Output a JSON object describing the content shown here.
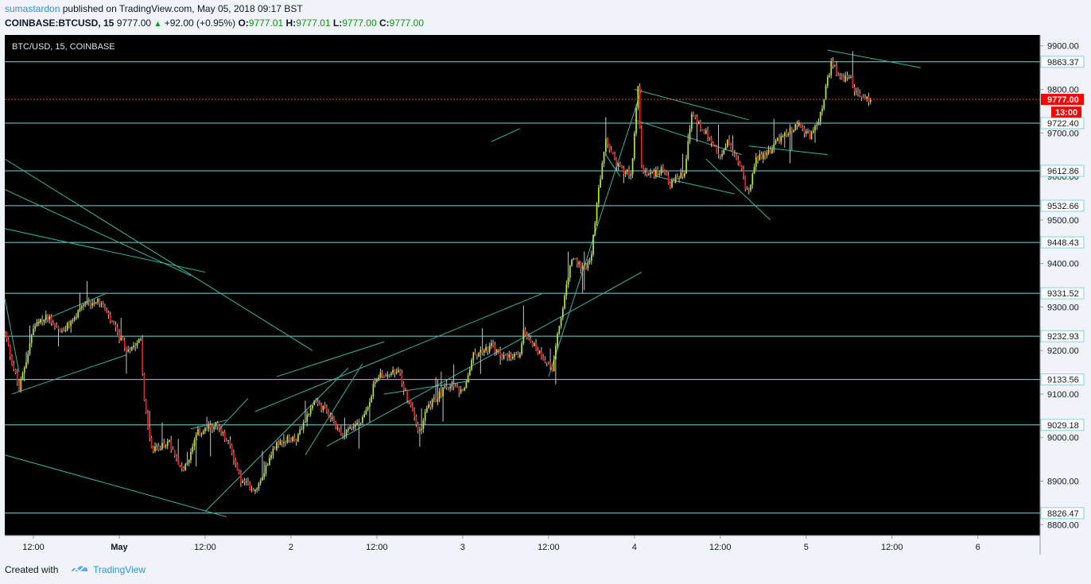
{
  "header": {
    "author": "sumastardon",
    "published_text": "published on TradingView.com, May 05, 2018 09:17 BST",
    "symbol": "COINBASE:BTCUSD, 15",
    "last": "9777.00",
    "change": "+92.00 (+0.95%)",
    "o_label": "O:",
    "o_val": "9777.01",
    "h_label": "H:",
    "h_val": "9777.01",
    "l_label": "L:",
    "l_val": "9777.00",
    "c_label": "C:",
    "c_val": "9777.00"
  },
  "footer": {
    "created_with": "Created with",
    "brand": "TradingView"
  },
  "colors": {
    "background": "#000000",
    "bull": "#b6ee20",
    "bear": "#ff1a1a",
    "level_line": "#7fd6d8",
    "trend_line": "#36b4a0",
    "current_price": "#ff0000",
    "axis_bg": "#f0f3fa"
  },
  "chart_data": {
    "type": "candlestick",
    "title": "BTC/USD, 15, COINBASE",
    "ylim": [
      8775,
      9925
    ],
    "y_ticks": [
      8800,
      8900,
      9000,
      9100,
      9200,
      9300,
      9400,
      9500,
      9600,
      9700,
      9800,
      9900
    ],
    "y_tick_labels": [
      "8800.00",
      "8900.00",
      "9000.00",
      "9100.00",
      "9200.00",
      "9300.00",
      "9400.00",
      "9500.00",
      "9600.00",
      "9700.00",
      "9800.00",
      "9900.00"
    ],
    "x_ticks": [
      {
        "hour": -84,
        "label": "12:00",
        "bold": false
      },
      {
        "hour": -72,
        "label": "May",
        "bold": true
      },
      {
        "hour": -60,
        "label": "12:00",
        "bold": false
      },
      {
        "hour": -48,
        "label": "2",
        "bold": false
      },
      {
        "hour": -36,
        "label": "12:00",
        "bold": false
      },
      {
        "hour": -24,
        "label": "3",
        "bold": false
      },
      {
        "hour": -12,
        "label": "12:00",
        "bold": false
      },
      {
        "hour": 0,
        "label": "4",
        "bold": false
      },
      {
        "hour": 12,
        "label": "12:00",
        "bold": false
      },
      {
        "hour": 24,
        "label": "5",
        "bold": false
      },
      {
        "hour": 36,
        "label": "12:00",
        "bold": false
      },
      {
        "hour": 48,
        "label": "6",
        "bold": false
      }
    ],
    "x_range_hours": [
      -88,
      56.7
    ],
    "candle_interval_hours": 0.25,
    "levels": [
      9863.37,
      9722.4,
      9612.86,
      9532.66,
      9448.43,
      9331.52,
      9232.93,
      9133.56,
      9029.18,
      8826.47
    ],
    "level_labels": [
      "9863.37",
      "9722.40",
      "9612.86",
      "9532.66",
      "9448.43",
      "9331.52",
      "9232.93",
      "9133.56",
      "9029.18",
      "8826.47"
    ],
    "current_price": 9777.0,
    "current_price_label": "9777.00",
    "countdown_label": "13:00",
    "trend_lines": [
      {
        "from": [
          -88,
          9640
        ],
        "to": [
          -45,
          9200
        ]
      },
      {
        "from": [
          -88,
          9570
        ],
        "to": [
          -62,
          9372
        ]
      },
      {
        "from": [
          -88,
          9480
        ],
        "to": [
          -60,
          9380
        ]
      },
      {
        "from": [
          -88,
          8960
        ],
        "to": [
          -57,
          8818
        ]
      },
      {
        "from": [
          -88,
          9320
        ],
        "to": [
          -86,
          9150
        ]
      },
      {
        "from": [
          -84,
          9260
        ],
        "to": [
          -74,
          9330
        ]
      },
      {
        "from": [
          -87,
          9100
        ],
        "to": [
          -71,
          9190
        ]
      },
      {
        "from": [
          -60,
          8830
        ],
        "to": [
          -40,
          9160
        ]
      },
      {
        "from": [
          -53,
          9060
        ],
        "to": [
          -13,
          9330
        ]
      },
      {
        "from": [
          -46,
          8960
        ],
        "to": [
          -38,
          9170
        ]
      },
      {
        "from": [
          -43,
          8980
        ],
        "to": [
          1,
          9380
        ]
      },
      {
        "from": [
          -35,
          9100
        ],
        "to": [
          -23,
          9130
        ]
      },
      {
        "from": [
          -12,
          9140
        ],
        "to": [
          1,
          9800
        ]
      },
      {
        "from": [
          0,
          9800
        ],
        "to": [
          16,
          9730
        ]
      },
      {
        "from": [
          -4,
          9650
        ],
        "to": [
          -2,
          9600
        ]
      },
      {
        "from": [
          3,
          9600
        ],
        "to": [
          14,
          9560
        ]
      },
      {
        "from": [
          10,
          9640
        ],
        "to": [
          19,
          9500
        ]
      },
      {
        "from": [
          0,
          9730
        ],
        "to": [
          15,
          9650
        ]
      },
      {
        "from": [
          16,
          9670
        ],
        "to": [
          27,
          9650
        ]
      },
      {
        "from": [
          27,
          9890
        ],
        "to": [
          40,
          9850
        ]
      },
      {
        "from": [
          -20,
          9680
        ],
        "to": [
          -16,
          9710
        ]
      },
      {
        "from": [
          -50,
          9140
        ],
        "to": [
          -35,
          9220
        ]
      },
      {
        "from": [
          -62,
          9020
        ],
        "to": [
          -57,
          9040
        ]
      },
      {
        "from": [
          -58,
          9020
        ],
        "to": [
          -54,
          9090
        ]
      }
    ],
    "anchors": [
      [
        -88,
        9240
      ],
      [
        -86,
        9110
      ],
      [
        -84,
        9250
      ],
      [
        -82,
        9280
      ],
      [
        -80,
        9240
      ],
      [
        -77,
        9300
      ],
      [
        -75,
        9320
      ],
      [
        -73,
        9260
      ],
      [
        -71,
        9200
      ],
      [
        -69,
        9230
      ],
      [
        -68.5,
        9080
      ],
      [
        -67.5,
        8970
      ],
      [
        -65,
        8990
      ],
      [
        -63,
        8920
      ],
      [
        -61,
        9010
      ],
      [
        -58.5,
        9030
      ],
      [
        -56.5,
        8980
      ],
      [
        -55,
        8900
      ],
      [
        -53,
        8880
      ],
      [
        -50,
        8990
      ],
      [
        -47,
        9000
      ],
      [
        -45,
        9080
      ],
      [
        -43,
        9060
      ],
      [
        -41,
        9010
      ],
      [
        -38,
        9040
      ],
      [
        -36,
        9140
      ],
      [
        -33,
        9150
      ],
      [
        -31,
        9060
      ],
      [
        -30,
        9010
      ],
      [
        -29,
        9070
      ],
      [
        -26,
        9120
      ],
      [
        -24,
        9100
      ],
      [
        -22.5,
        9190
      ],
      [
        -20,
        9210
      ],
      [
        -18,
        9180
      ],
      [
        -16,
        9190
      ],
      [
        -15.5,
        9250
      ],
      [
        -14,
        9210
      ],
      [
        -12.5,
        9180
      ],
      [
        -11.5,
        9160
      ],
      [
        -10,
        9300
      ],
      [
        -8.8,
        9410
      ],
      [
        -7,
        9390
      ],
      [
        -6,
        9420
      ],
      [
        -5,
        9570
      ],
      [
        -4,
        9680
      ],
      [
        -2.5,
        9630
      ],
      [
        -0.5,
        9600
      ],
      [
        0.5,
        9800
      ],
      [
        1,
        9620
      ],
      [
        2,
        9600
      ],
      [
        4,
        9620
      ],
      [
        5,
        9580
      ],
      [
        7,
        9610
      ],
      [
        8,
        9740
      ],
      [
        10,
        9700
      ],
      [
        12,
        9640
      ],
      [
        13,
        9680
      ],
      [
        15,
        9610
      ],
      [
        15.8,
        9560
      ],
      [
        17,
        9640
      ],
      [
        19,
        9660
      ],
      [
        21,
        9700
      ],
      [
        23,
        9720
      ],
      [
        24.5,
        9690
      ],
      [
        26,
        9740
      ],
      [
        27.5,
        9860
      ],
      [
        29,
        9820
      ],
      [
        30,
        9830
      ],
      [
        31,
        9790
      ],
      [
        32,
        9780
      ],
      [
        33,
        9777
      ]
    ]
  }
}
